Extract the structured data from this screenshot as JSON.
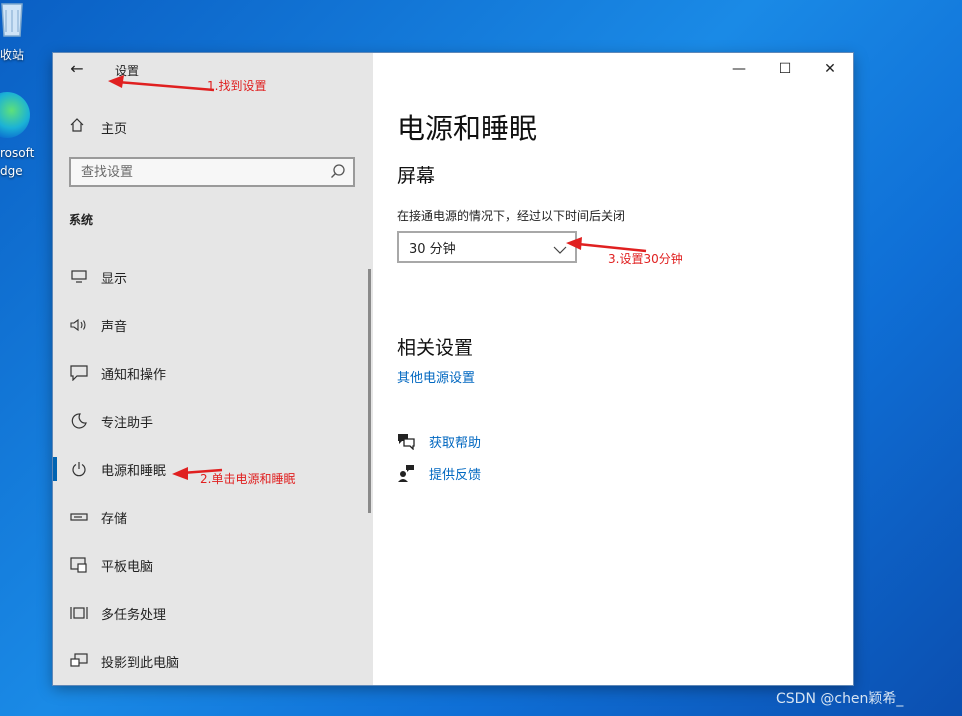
{
  "desktop": {
    "recycle_bin_label": "收站",
    "edge_label_line1": "rosoft",
    "edge_label_line2": "dge"
  },
  "window": {
    "title": "设置",
    "controls": {
      "minimize": "—",
      "maximize": "☐",
      "close": "✕"
    }
  },
  "sidebar": {
    "home_label": "主页",
    "search_placeholder": "查找设置",
    "section_label": "系统",
    "items": [
      {
        "label": "显示",
        "icon": "monitor-icon",
        "active": false
      },
      {
        "label": "声音",
        "icon": "speaker-icon",
        "active": false
      },
      {
        "label": "通知和操作",
        "icon": "notification-icon",
        "active": false
      },
      {
        "label": "专注助手",
        "icon": "moon-icon",
        "active": false
      },
      {
        "label": "电源和睡眠",
        "icon": "power-icon",
        "active": true
      },
      {
        "label": "存储",
        "icon": "storage-icon",
        "active": false
      },
      {
        "label": "平板电脑",
        "icon": "tablet-icon",
        "active": false
      },
      {
        "label": "多任务处理",
        "icon": "multitask-icon",
        "active": false
      },
      {
        "label": "投影到此电脑",
        "icon": "project-icon",
        "active": false
      }
    ]
  },
  "main": {
    "page_title": "电源和睡眠",
    "screen_heading": "屏幕",
    "screen_description": "在接通电源的情况下，经过以下时间后关闭",
    "screen_timeout_value": "30 分钟",
    "related_heading": "相关设置",
    "other_power_link": "其他电源设置",
    "get_help_link": "获取帮助",
    "feedback_link": "提供反馈"
  },
  "annotations": {
    "step1": "1.找到设置",
    "step2": "2.单击电源和睡眠",
    "step3": "3.设置30分钟",
    "color": "#e02020"
  },
  "watermark": "CSDN @chen颖希_",
  "colors": {
    "accent": "#0063b1",
    "link": "#0067c0",
    "sidebar_bg": "#e6e6e6"
  }
}
